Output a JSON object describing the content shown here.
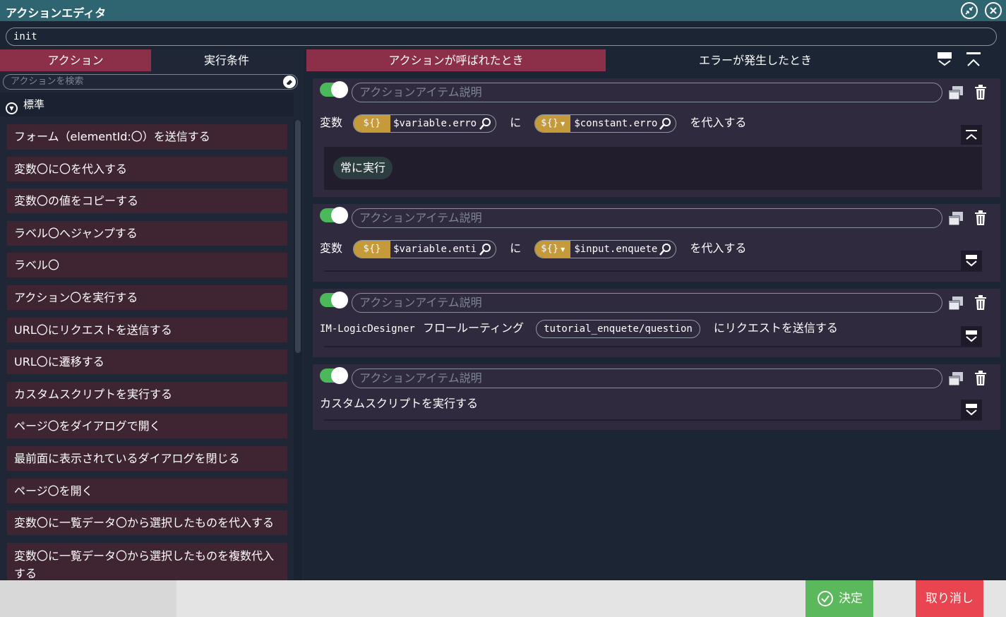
{
  "window": {
    "title": "アクションエディタ"
  },
  "event_name": "init",
  "left_panel": {
    "tabs": [
      "アクション",
      "実行条件"
    ],
    "search_placeholder": "アクションを検索",
    "category": "標準",
    "actions": [
      "フォーム（elementId:〇）を送信する",
      "変数〇に〇を代入する",
      "変数〇の値をコピーする",
      "ラベル〇へジャンプする",
      "ラベル〇",
      "アクション〇を実行する",
      "URL〇にリクエストを送信する",
      "URL〇に遷移する",
      "カスタムスクリプトを実行する",
      "ページ〇をダイアログで開く",
      "最前面に表示されているダイアログを閉じる",
      "ページ〇を開く",
      "変数〇に一覧データ〇から選択したものを代入する",
      "変数〇に一覧データ〇から選択したものを複数代入する"
    ]
  },
  "right_panel": {
    "tabs": [
      "アクションが呼ばれたとき",
      "エラーが発生したとき"
    ],
    "item_placeholder": "アクションアイテム説明",
    "items": [
      {
        "prefix": "変数",
        "var_symbol": "${}",
        "var_value": "$variable.erro",
        "connector": "に",
        "src_symbol": "${}",
        "src_value": "$constant.erro",
        "suffix": "を代入する",
        "condition": "常に実行"
      },
      {
        "prefix": "変数",
        "var_symbol": "${}",
        "var_value": "$variable.enti",
        "connector": "に",
        "src_symbol": "${}",
        "src_value": "$input.enquete",
        "suffix": "を代入する"
      },
      {
        "prefix": "IM-LogicDesigner",
        "middle": "フロールーティング",
        "url": "tutorial_enquete/question",
        "suffix": "にリクエストを送信する"
      },
      {
        "text": "カスタムスクリプトを実行する"
      }
    ]
  },
  "footer": {
    "ok_label": "決定",
    "cancel_label": "取り消し"
  },
  "colors": {
    "titlebar": "#2e6570",
    "active_tab": "#8c3049",
    "action_item": "#3f2431",
    "card": "#302a3e",
    "toggle_on": "#4cb85c",
    "variable_symbol": "#c49a3a",
    "ok_button": "#5cb85c",
    "cancel_button": "#e94550"
  },
  "icons": [
    "restore-icon",
    "close-icon",
    "eraser-icon",
    "collapse-circle-icon",
    "expand-all-icon",
    "collapse-all-icon",
    "copy-icon",
    "trash-icon",
    "magnifier-icon",
    "chevron-down-icon",
    "chevron-up-icon",
    "check-circle-icon"
  ]
}
